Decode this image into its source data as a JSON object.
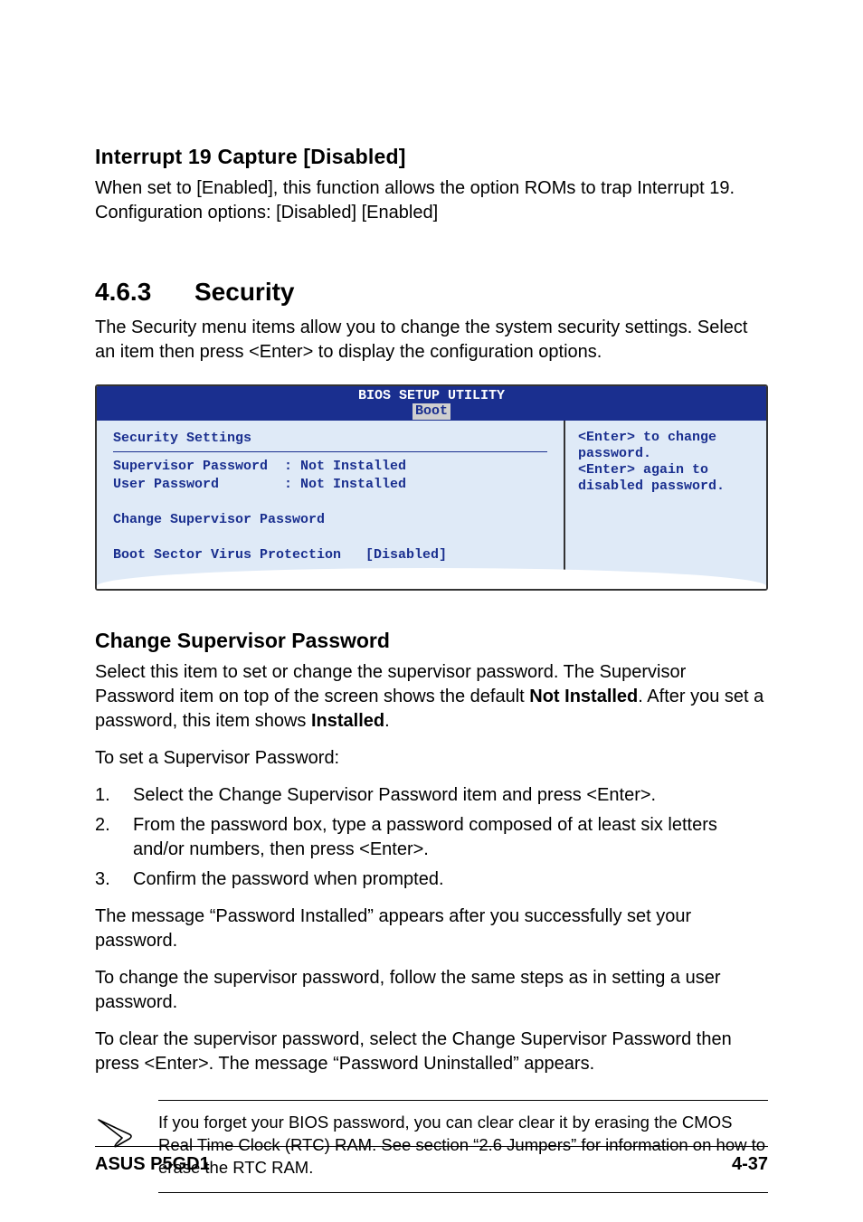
{
  "sec1": {
    "title": "Interrupt 19 Capture [Disabled]",
    "body": "When set to [Enabled], this function allows the option ROMs to trap Interrupt 19. Configuration options: [Disabled] [Enabled]"
  },
  "sec2": {
    "num": "4.6.3",
    "title": "Security",
    "intro": "The Security menu items allow you to change the system security settings. Select an item then press <Enter> to display the configuration options."
  },
  "bios": {
    "header_title": "BIOS SETUP UTILITY",
    "header_tab": "Boot",
    "left_title": "Security Settings",
    "rows": [
      "Supervisor Password  : Not Installed",
      "User Password        : Not Installed"
    ],
    "change_line": "Change Supervisor Password",
    "boot_line": "Boot Sector Virus Protection   [Disabled]",
    "help1": "<Enter> to change",
    "help2": "password.",
    "help3": "<Enter> again to",
    "help4": "disabled password."
  },
  "sec3": {
    "title": "Change Supervisor Password",
    "p1a": "Select this item to set or change the supervisor password. The Supervisor Password item on top of the screen shows the default ",
    "p1b": "Not Installed",
    "p1c": ". After you set a password, this item shows ",
    "p1d": "Installed",
    "p1e": ".",
    "p2": "To set a Supervisor Password:",
    "steps": [
      "Select the Change Supervisor Password item and press <Enter>.",
      "From the password box, type a password composed of at least six letters and/or numbers, then press <Enter>.",
      "Confirm the password when prompted."
    ],
    "p3": "The message “Password Installed” appears after you successfully set your password.",
    "p4": "To change the supervisor password, follow the same steps as in setting a user password.",
    "p5": "To clear the supervisor password, select the Change Supervisor Password then press <Enter>. The message “Password Uninstalled” appears."
  },
  "note": {
    "text": "If you forget your BIOS password, you can clear clear it by erasing the CMOS Real Time Clock (RTC) RAM. See section “2.6  Jumpers” for information on how to erase the RTC RAM."
  },
  "footer": {
    "left": "ASUS P5GD1",
    "right": "4-37"
  }
}
